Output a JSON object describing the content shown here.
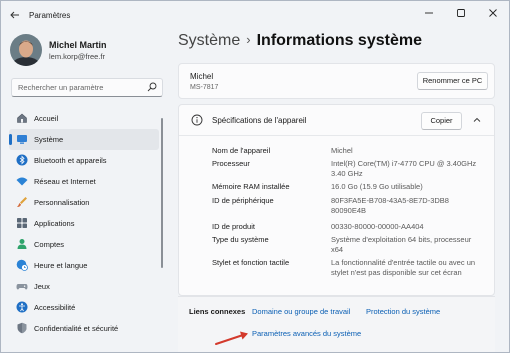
{
  "window": {
    "app_title": "Paramètres",
    "back_icon": "arrow-left-icon",
    "controls": [
      "minimize-icon",
      "maximize-icon",
      "close-icon"
    ]
  },
  "profile": {
    "name": "Michel Martin",
    "email": "lem.korp@free.fr"
  },
  "search": {
    "placeholder": "Rechercher un paramètre"
  },
  "sidebar": {
    "items": [
      {
        "label": "Accueil",
        "icon": "home-icon",
        "active": false
      },
      {
        "label": "Système",
        "icon": "system-icon",
        "active": true
      },
      {
        "label": "Bluetooth et appareils",
        "icon": "bluetooth-icon",
        "active": false
      },
      {
        "label": "Réseau et Internet",
        "icon": "wifi-icon",
        "active": false
      },
      {
        "label": "Personnalisation",
        "icon": "brush-icon",
        "active": false
      },
      {
        "label": "Applications",
        "icon": "apps-icon",
        "active": false
      },
      {
        "label": "Comptes",
        "icon": "account-icon",
        "active": false
      },
      {
        "label": "Heure et langue",
        "icon": "globe-clock-icon",
        "active": false
      },
      {
        "label": "Jeux",
        "icon": "gamepad-icon",
        "active": false
      },
      {
        "label": "Accessibilité",
        "icon": "accessibility-icon",
        "active": false
      },
      {
        "label": "Confidentialité et sécurité",
        "icon": "shield-icon",
        "active": false
      }
    ]
  },
  "breadcrumb": {
    "parent": "Système",
    "separator": "›",
    "current": "Informations système"
  },
  "device": {
    "name": "Michel",
    "model": "MS-7817",
    "rename_label": "Renommer ce PC"
  },
  "specs": {
    "title": "Spécifications de l'appareil",
    "copy_label": "Copier",
    "rows": [
      {
        "label": "Nom de l'appareil",
        "value": "Michel"
      },
      {
        "label": "Processeur",
        "value": "Intel(R) Core(TM) i7-4770 CPU @ 3.40GHz 3.40 GHz"
      },
      {
        "label": "Mémoire RAM installée",
        "value": "16.0 Go (15.9 Go utilisable)"
      },
      {
        "label": "ID de périphérique",
        "value": "80F3FA5E-B708-43A5-8E7D-3DB880090E4B"
      },
      {
        "label": "ID de produit",
        "value": "00330-80000-00000-AA404"
      },
      {
        "label": "Type du système",
        "value": "Système d'exploitation 64 bits, processeur x64"
      },
      {
        "label": "Stylet et fonction tactile",
        "value": "La fonctionnalité d'entrée tactile ou avec un stylet n'est pas disponible sur cet écran"
      }
    ]
  },
  "related": {
    "title": "Liens connexes",
    "links": [
      "Domaine ou groupe de travail",
      "Protection du système",
      "Paramètres avancés du système"
    ]
  },
  "accent_color": "#1f6fc5",
  "annotation_arrow_color": "#d33a2c"
}
